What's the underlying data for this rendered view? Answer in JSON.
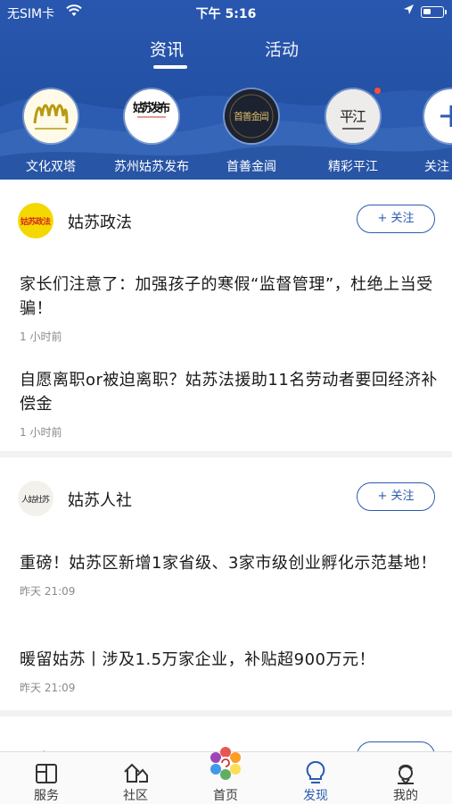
{
  "status_bar": {
    "carrier": "无SIM卡",
    "time": "下午 5:16"
  },
  "tabs": [
    {
      "label": "资讯",
      "active": true
    },
    {
      "label": "活动",
      "active": false
    }
  ],
  "channels": [
    {
      "label": "文化双塔",
      "icon": "wenhua-shuangta-logo",
      "logo_text": ""
    },
    {
      "label": "苏州姑苏发布",
      "icon": "gusu-fabu-logo",
      "logo_text": "姑苏发布"
    },
    {
      "label": "首善金阊",
      "icon": "shoushan-jinchang-logo",
      "logo_text": "首善金阊"
    },
    {
      "label": "精彩平江",
      "icon": "pingjiang-logo",
      "logo_text": "平江",
      "has_dot": true
    },
    {
      "label": "关注",
      "icon": "plus-icon"
    }
  ],
  "cards": [
    {
      "account": "姑苏政法",
      "avatar_text": "姑苏政法",
      "follow_label": "+ 关注",
      "articles": [
        {
          "title": "家长们注意了：加强孩子的寒假“监督管理”，杜绝上当受骗！",
          "time": "1 小时前"
        },
        {
          "title": "自愿离职or被迫离职？姑苏法援助11名劳动者要回经济补偿金",
          "time": "1 小时前"
        }
      ]
    },
    {
      "account": "姑苏人社",
      "avatar_text": "人姑社苏",
      "follow_label": "+ 关注",
      "articles": [
        {
          "title": "重磅！姑苏区新增1家省级、3家市级创业孵化示范基地！",
          "time": "昨天 21:09"
        },
        {
          "title": "暖留姑苏丨涉及1.5万家企业，补贴超900万元！",
          "time": "昨天 21:09"
        }
      ]
    },
    {
      "account": "",
      "follow_label": ""
    }
  ],
  "bottom_tabs": [
    {
      "label": "服务",
      "icon": "service-icon",
      "active": false
    },
    {
      "label": "社区",
      "icon": "community-icon",
      "active": false
    },
    {
      "label": "首页",
      "icon": "home-logo-icon",
      "active": false
    },
    {
      "label": "发现",
      "icon": "discover-bulb-icon",
      "active": true
    },
    {
      "label": "我的",
      "icon": "profile-icon",
      "active": false
    }
  ],
  "colors": {
    "header_blue": "#2452a6",
    "accent": "#2d5bb0",
    "badge_red": "#ff4d3b"
  }
}
